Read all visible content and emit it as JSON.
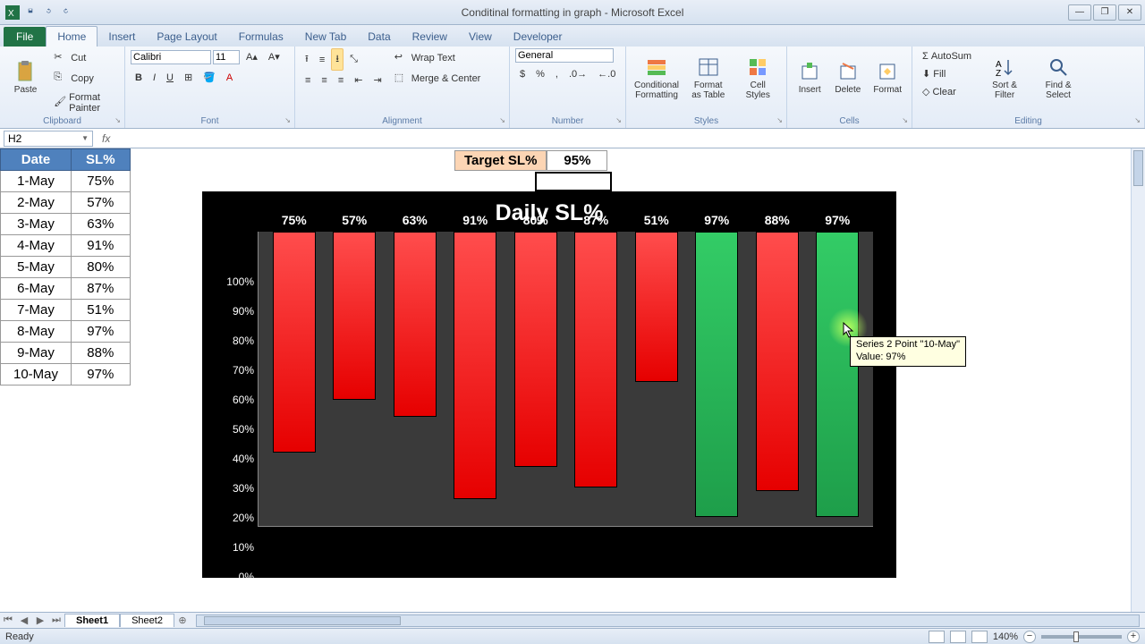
{
  "app": {
    "title": "Conditinal formatting in graph - Microsoft Excel",
    "tabs": [
      "Home",
      "Insert",
      "Page Layout",
      "Formulas",
      "New Tab",
      "Data",
      "Review",
      "View",
      "Developer"
    ],
    "file_label": "File"
  },
  "ribbon": {
    "clipboard": {
      "name": "Clipboard",
      "paste": "Paste",
      "cut": "Cut",
      "copy": "Copy",
      "painter": "Format Painter"
    },
    "font": {
      "name": "Font",
      "family": "Calibri",
      "size": "11"
    },
    "alignment": {
      "name": "Alignment",
      "wrap": "Wrap Text",
      "merge": "Merge & Center"
    },
    "number": {
      "name": "Number",
      "format": "General"
    },
    "styles": {
      "name": "Styles",
      "cond": "Conditional Formatting",
      "fmttable": "Format as Table",
      "cellstyles": "Cell Styles"
    },
    "cells": {
      "name": "Cells",
      "insert": "Insert",
      "delete": "Delete",
      "format": "Format"
    },
    "editing": {
      "name": "Editing",
      "autosum": "AutoSum",
      "fill": "Fill",
      "clear": "Clear",
      "sort": "Sort & Filter",
      "find": "Find & Select"
    }
  },
  "formula_bar": {
    "cell_ref": "H2",
    "formula": ""
  },
  "table": {
    "headers": [
      "Date",
      "SL%"
    ],
    "rows": [
      [
        "1-May",
        "75%"
      ],
      [
        "2-May",
        "57%"
      ],
      [
        "3-May",
        "63%"
      ],
      [
        "4-May",
        "91%"
      ],
      [
        "5-May",
        "80%"
      ],
      [
        "6-May",
        "87%"
      ],
      [
        "7-May",
        "51%"
      ],
      [
        "8-May",
        "97%"
      ],
      [
        "9-May",
        "88%"
      ],
      [
        "10-May",
        "97%"
      ]
    ]
  },
  "target": {
    "label": "Target SL%",
    "value": "95%"
  },
  "tooltip": {
    "line1": "Series 2 Point \"10-May\"",
    "line2": "Value: 97%"
  },
  "sheets": {
    "active": "Sheet1",
    "other": "Sheet2"
  },
  "status": {
    "ready": "Ready",
    "zoom": "140%"
  },
  "chart_data": {
    "type": "bar",
    "title": "Daily SL%",
    "categories": [
      "1-May",
      "2-May",
      "3-May",
      "4-May",
      "5-May",
      "6-May",
      "7-May",
      "8-May",
      "9-May",
      "10-May"
    ],
    "values": [
      75,
      57,
      63,
      91,
      80,
      87,
      51,
      97,
      88,
      97
    ],
    "threshold": 95,
    "colors": {
      "below": "#e60000",
      "meets": "#1e9e4a"
    },
    "ylabel": "",
    "xlabel": "",
    "ylim": [
      0,
      100
    ],
    "yticks": [
      0,
      10,
      20,
      30,
      40,
      50,
      60,
      70,
      80,
      90,
      100
    ]
  }
}
